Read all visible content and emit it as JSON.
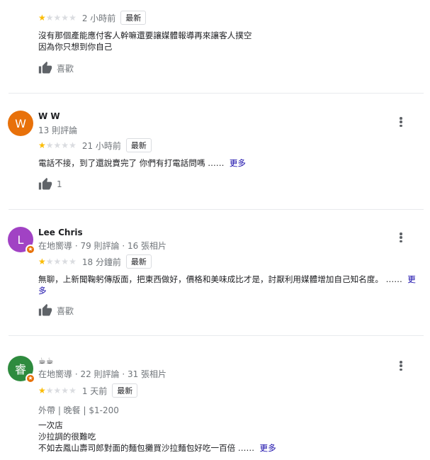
{
  "reviews": [
    {
      "time": "2 小時前",
      "badge": "最新",
      "text_lines": [
        "沒有那個產能應付客人幹嘛還要讓媒體報導再來讓客人撲空",
        "因為你只想到你自己"
      ],
      "like_label": "喜歡"
    },
    {
      "avatar_letter": "W",
      "avatar_color": "#e8710a",
      "name": "W W",
      "meta": "13 則評論",
      "time": "21 小時前",
      "badge": "最新",
      "text": "電話不接，到了還說賣完了 你們有打電話問嗎 ……",
      "more": "更多",
      "like_count": "1"
    },
    {
      "avatar_letter": "L",
      "avatar_color": "#a142c4",
      "name": "Lee Chris",
      "meta": "在地嚮導 · 79 則評論 · 16 張相片",
      "time": "18 分鐘前",
      "badge": "最新",
      "text": "無聊，上新聞鞠躬傳版面，把東西做好，價格和美味成比才是，討厭利用媒體增加自己知名度。 ……",
      "more": "更多",
      "like_label": "喜歡"
    },
    {
      "avatar_letter": "睿",
      "avatar_color": "#2e8b3e",
      "name": "☕☕",
      "meta": "在地嚮導 · 22 則評論 · 31 張相片",
      "time": "1 天前",
      "badge": "最新",
      "tags": "外帶 | 晚餐 | $1-200",
      "text_lines": [
        "一次店",
        "沙拉調的很難吃"
      ],
      "text_last": "不如去鳳山壽司郎對面的麵包攤買沙拉麵包好吃一百倍 ……",
      "more": "更多"
    }
  ],
  "rating": 1,
  "icons": {
    "star": "star-icon",
    "thumb": "thumbs-up-icon",
    "more": "more-vert-icon",
    "guide": "local-guide-icon"
  },
  "colors": {
    "star_on": "#fbbc04",
    "star_off": "#dadce0",
    "link": "#1a0dab"
  }
}
